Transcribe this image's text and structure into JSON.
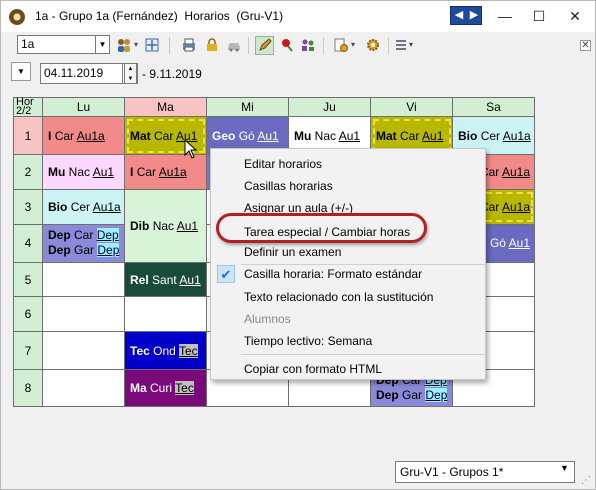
{
  "window": {
    "title": "1a - Grupo 1a (Fernández)  Horarios  (Gru-V1)",
    "nav_left": "◀",
    "nav_right": "▶",
    "minimize": "—",
    "maximize": "☐",
    "close": "✕"
  },
  "toolbar": {
    "class_value": "1a",
    "icons": [
      "users-icon",
      "move-icon",
      "print-icon",
      "lock-icon",
      "car-icon",
      "pencil-icon",
      "pin-icon",
      "people-icon",
      "gear-doc-icon",
      "settings-icon",
      "list-icon"
    ]
  },
  "dates": {
    "start": "04.11.2019",
    "end": "- 9.11.2019"
  },
  "grid": {
    "corner_top": "Hor",
    "corner_bottom": "2/2",
    "days": [
      "Lu",
      "Ma",
      "Mi",
      "Ju",
      "Vi",
      "Sa"
    ],
    "periods": [
      "1",
      "2",
      "3",
      "4",
      "5",
      "6",
      "7",
      "8"
    ],
    "cells": {
      "lu1": {
        "subj": "I",
        "teacher": "Car",
        "room": "Au1a"
      },
      "ma1": {
        "subj": "Mat",
        "teacher": "Car",
        "room": "Au1"
      },
      "mi1": {
        "subj": "Geo",
        "teacher": "Gó",
        "room": "Au1"
      },
      "ju1": {
        "subj": "Mu",
        "teacher": "Nac",
        "room": "Au1"
      },
      "vi1": {
        "subj": "Mat",
        "teacher": "Car",
        "room": "Au1"
      },
      "sa1": {
        "subj": "Bio",
        "teacher": "Cer",
        "room": "Au1a"
      },
      "lu2": {
        "subj": "Mu",
        "teacher": "Nac",
        "room": "Au1"
      },
      "ma2": {
        "subj": "I",
        "teacher": "Car",
        "room": "Au1a"
      },
      "sa2": {
        "subj": "",
        "teacher": "Car",
        "room": "Au1a"
      },
      "lu3": {
        "subj": "Bio",
        "teacher": "Cer",
        "room": "Au1a"
      },
      "ma34": {
        "subj": "Dib",
        "teacher": "Nac",
        "room": "Au1"
      },
      "sa3": {
        "subj": "",
        "teacher": "Car",
        "room": "Au1a"
      },
      "lu4a": {
        "subj": "Dep",
        "teacher": "Car",
        "room": "Dep"
      },
      "lu4b": {
        "subj": "Dep",
        "teacher": "Gar",
        "room": "Dep"
      },
      "sa4": {
        "subj": "",
        "teacher": "Gó",
        "room": "Au1"
      },
      "ma5": {
        "subj": "Rel",
        "teacher": "Sant",
        "room": "Au1"
      },
      "ma7": {
        "subj": "Tec",
        "teacher": "Ond",
        "room": "Tec"
      },
      "ma8": {
        "subj": "Ma",
        "teacher": "Curi",
        "room": "Tec"
      },
      "vi8a": {
        "subj": "Dep",
        "teacher": "Car",
        "room": "Dep"
      },
      "vi8b": {
        "subj": "Dep",
        "teacher": "Gar",
        "room": "Dep"
      }
    }
  },
  "context_menu": {
    "items": [
      "Editar horarios",
      "Casillas horarias",
      "Asignar un aula (+/-)",
      "Tarea especial / Cambiar horas",
      "Definir un examen",
      "Casilla horaria: Formato estándar",
      "Texto relacionado con la sustitución",
      "Alumnos",
      "Tiempo lectivo: Semana",
      "Copiar con formato HTML"
    ]
  },
  "status": {
    "view": "Gru-V1 - Grupos 1*"
  },
  "colors": {
    "mat": "#b8b800",
    "rel": "#1a4a3a",
    "tec": "#0000c8",
    "ma": "#7a0a7a",
    "dep": "#8a8ad8",
    "geo": "#6a6ac0",
    "red": "#f08080",
    "header_green": "#d3efd3"
  }
}
